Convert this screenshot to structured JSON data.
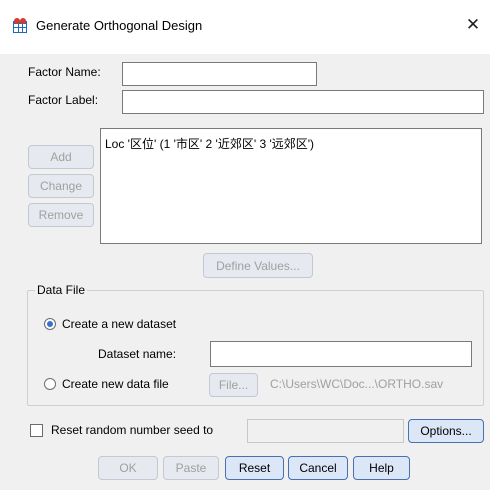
{
  "window": {
    "title": "Generate Orthogonal Design",
    "close_glyph": "✕",
    "app_icon": "spss-table-icon"
  },
  "fields": {
    "factor_name_label": "Factor Name:",
    "factor_name_value": "",
    "factor_label_label": "Factor Label:",
    "factor_label_value": ""
  },
  "factor_list": {
    "items": [
      "Loc '区位' (1 '市区' 2 '近郊区' 3 '远郊区')"
    ]
  },
  "list_buttons": {
    "add": "Add",
    "change": "Change",
    "remove": "Remove"
  },
  "define_values_button": "Define Values...",
  "data_file": {
    "group_title": "Data File",
    "create_new_dataset_label": "Create a new dataset",
    "create_new_dataset_selected": true,
    "dataset_name_label": "Dataset name:",
    "dataset_name_value": "",
    "create_new_data_file_label": "Create new data file",
    "create_new_data_file_selected": false,
    "file_button": "File...",
    "file_path": "C:\\Users\\WC\\Doc...\\ORTHO.sav"
  },
  "seed": {
    "label": "Reset random number seed to",
    "checked": false,
    "value": ""
  },
  "options_button": "Options...",
  "footer": {
    "ok": "OK",
    "paste": "Paste",
    "reset": "Reset",
    "cancel": "Cancel",
    "help": "Help"
  }
}
